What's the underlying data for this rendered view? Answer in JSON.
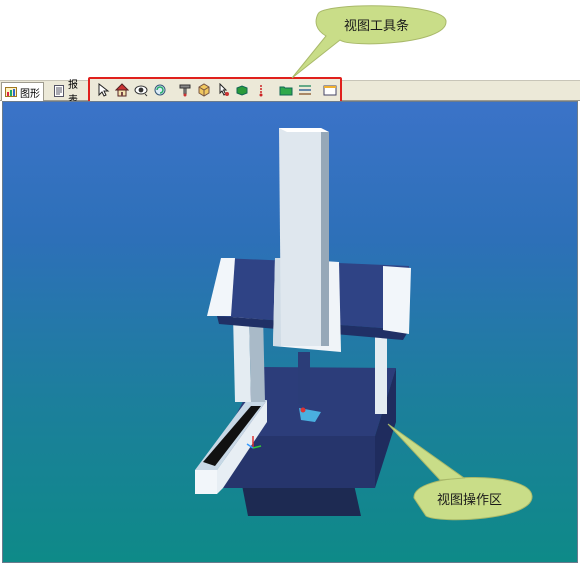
{
  "tabs": [
    {
      "label": "图形",
      "icon": "chart-icon"
    },
    {
      "label": "报表",
      "icon": "report-icon"
    }
  ],
  "toolbar": {
    "items": [
      "select-arrow-icon",
      "home-view-icon",
      "eye-view-icon",
      "rotate-view-icon",
      "probe-icon",
      "cube-select-icon",
      "pick-arrow-icon",
      "green-cube-icon",
      "red-marker-icon",
      "green-folder-icon",
      "layers-icon",
      "window-icon"
    ]
  },
  "callouts": {
    "toolbar": "视图工具条",
    "viewport": "视图操作区"
  },
  "colors": {
    "highlight": "#e0201c",
    "bubble": "#c9dd88",
    "viewport_top": "#3b73c8",
    "viewport_bottom": "#0e8a88"
  }
}
